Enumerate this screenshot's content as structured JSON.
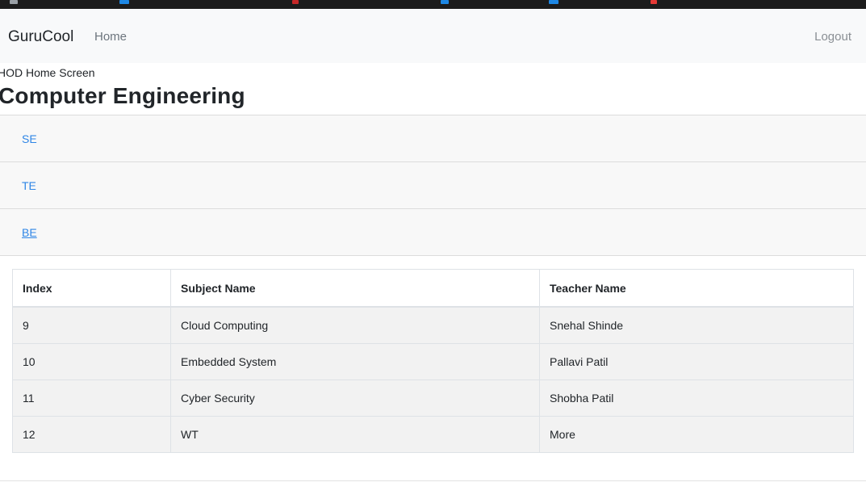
{
  "navbar": {
    "brand": "GuruCool",
    "home_link": "Home",
    "logout_link": "Logout"
  },
  "page": {
    "subtitle": "HOD Home Screen",
    "heading": "Computer Engineering"
  },
  "years": [
    {
      "label": "SE"
    },
    {
      "label": "TE"
    },
    {
      "label": "BE"
    }
  ],
  "table": {
    "headers": [
      "Index",
      "Subject Name",
      "Teacher Name"
    ],
    "rows": [
      [
        "9",
        "Cloud Computing",
        "Snehal Shinde"
      ],
      [
        "10",
        "Embedded System",
        "Pallavi Patil"
      ],
      [
        "11",
        "Cyber Security",
        "Shobha Patil"
      ],
      [
        "12",
        "WT",
        "More"
      ]
    ]
  },
  "colors": {
    "link": "#2f86e6",
    "navbar_bg": "#f8f9fa",
    "row_bg": "#f2f2f2"
  }
}
